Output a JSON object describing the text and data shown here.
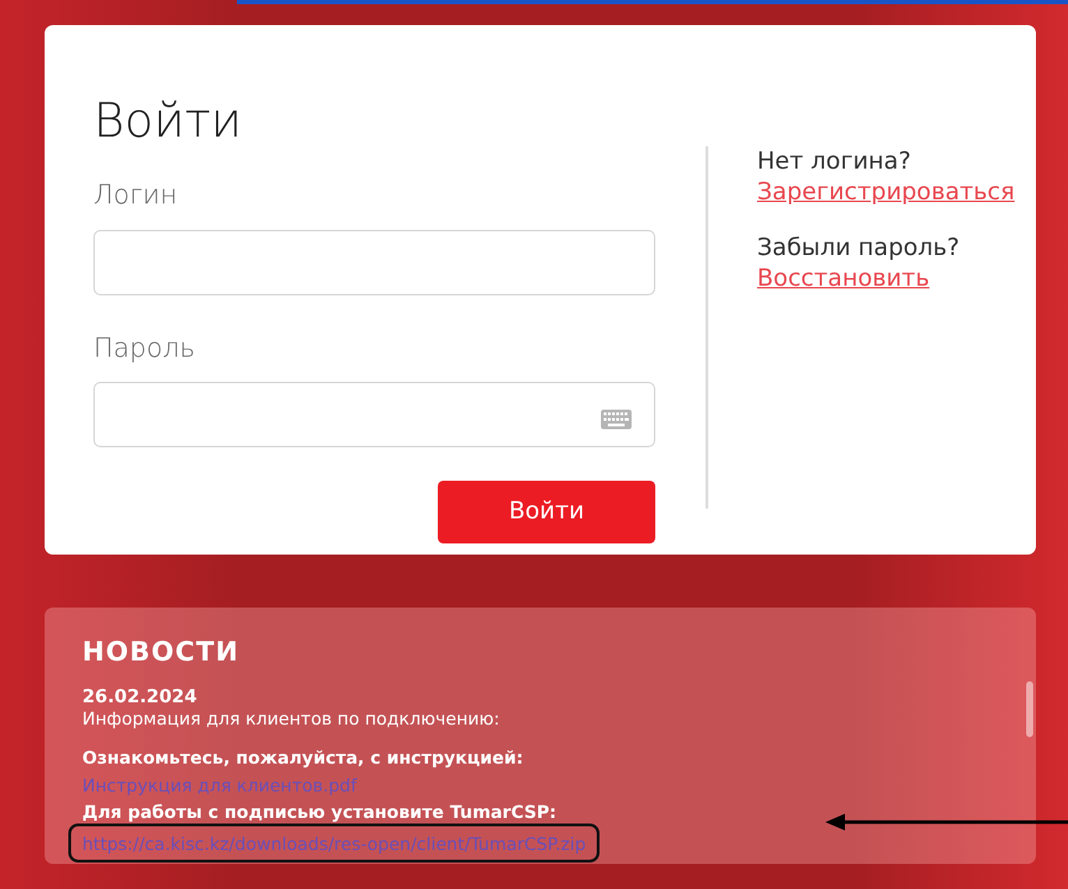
{
  "login_card": {
    "title": "Войти",
    "login_label": "Логин",
    "password_label": "Пароль",
    "submit": "Войти"
  },
  "side": [
    {
      "question": "Нет логина?",
      "link": "Зарегистрироваться"
    },
    {
      "question": "Забыли пароль?",
      "link": "Восстановить"
    }
  ],
  "news": {
    "heading": "НОВОСТИ",
    "date": "26.02.2024",
    "lines": [
      {
        "kind": "text",
        "text": "Информация для клиентов по подключению:"
      },
      {
        "kind": "gap"
      },
      {
        "kind": "bold",
        "text": "Ознакомьтесь, пожалуйста, с инструкцией:"
      },
      {
        "kind": "link",
        "text": "Инструкция для клиентов.pdf"
      },
      {
        "kind": "bold",
        "text": "Для работы с подписью установите TumarCSP:"
      },
      {
        "kind": "link",
        "text": "https://ca.kisc.kz/downloads/res-open/client/TumarCSP.zip",
        "highlighted": true
      }
    ]
  }
}
